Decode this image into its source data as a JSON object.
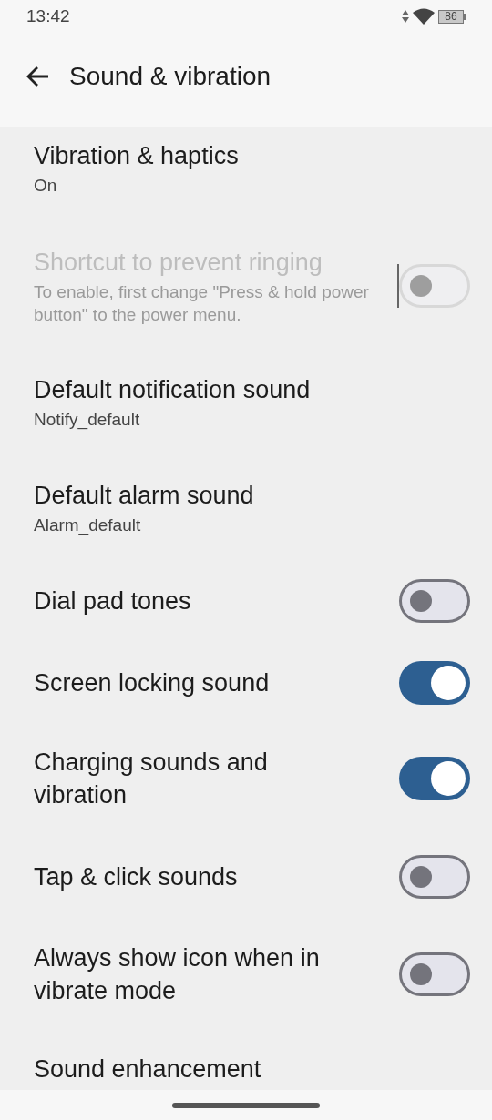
{
  "status_bar": {
    "time": "13:42",
    "battery": "86"
  },
  "header": {
    "title": "Sound & vibration"
  },
  "settings": [
    {
      "kind": "link",
      "title": "Vibration & haptics",
      "summary": "On",
      "disabled": false
    },
    {
      "kind": "switch",
      "title": "Shortcut to prevent ringing",
      "summary": "To enable, first change \"Press & hold power button\" to the power menu.",
      "disabled": true,
      "on": false
    },
    {
      "kind": "link",
      "title": "Default notification sound",
      "summary": "Notify_default",
      "disabled": false
    },
    {
      "kind": "link",
      "title": "Default alarm sound",
      "summary": "Alarm_default",
      "disabled": false
    },
    {
      "kind": "switch",
      "title": "Dial pad tones",
      "disabled": false,
      "on": false
    },
    {
      "kind": "switch",
      "title": "Screen locking sound",
      "disabled": false,
      "on": true
    },
    {
      "kind": "switch",
      "title": "Charging sounds and vibration",
      "disabled": false,
      "on": true
    },
    {
      "kind": "switch",
      "title": "Tap & click sounds",
      "disabled": false,
      "on": false
    },
    {
      "kind": "switch",
      "title": "Always show icon when in vibrate mode",
      "disabled": false,
      "on": false
    },
    {
      "kind": "link",
      "title": "Sound enhancement",
      "disabled": false
    }
  ]
}
